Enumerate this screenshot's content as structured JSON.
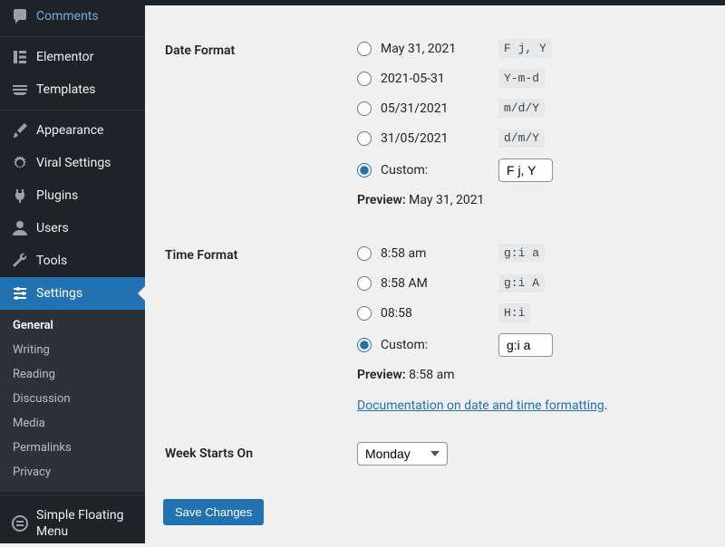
{
  "sidebar": {
    "items": [
      {
        "label": "Comments"
      },
      {
        "label": "Elementor"
      },
      {
        "label": "Templates"
      },
      {
        "label": "Appearance"
      },
      {
        "label": "Viral Settings"
      },
      {
        "label": "Plugins"
      },
      {
        "label": "Users"
      },
      {
        "label": "Tools"
      },
      {
        "label": "Settings"
      },
      {
        "label": "Simple Floating Menu"
      }
    ],
    "submenu": [
      {
        "label": "General"
      },
      {
        "label": "Writing"
      },
      {
        "label": "Reading"
      },
      {
        "label": "Discussion"
      },
      {
        "label": "Media"
      },
      {
        "label": "Permalinks"
      },
      {
        "label": "Privacy"
      }
    ]
  },
  "date_format": {
    "heading": "Date Format",
    "options": [
      {
        "example": "May 31, 2021",
        "code": "F j, Y"
      },
      {
        "example": "2021-05-31",
        "code": "Y-m-d"
      },
      {
        "example": "05/31/2021",
        "code": "m/d/Y"
      },
      {
        "example": "31/05/2021",
        "code": "d/m/Y"
      }
    ],
    "custom_label": "Custom:",
    "custom_value": "F j, Y",
    "preview_label": "Preview:",
    "preview_value": "May 31, 2021"
  },
  "time_format": {
    "heading": "Time Format",
    "options": [
      {
        "example": "8:58 am",
        "code": "g:i a"
      },
      {
        "example": "8:58 AM",
        "code": "g:i A"
      },
      {
        "example": "08:58",
        "code": "H:i"
      }
    ],
    "custom_label": "Custom:",
    "custom_value": "g:i a",
    "preview_label": "Preview:",
    "preview_value": "8:58 am"
  },
  "doc_link": "Documentation on date and time formatting",
  "doc_suffix": ".",
  "week_starts": {
    "heading": "Week Starts On",
    "value": "Monday"
  },
  "save_label": "Save Changes"
}
